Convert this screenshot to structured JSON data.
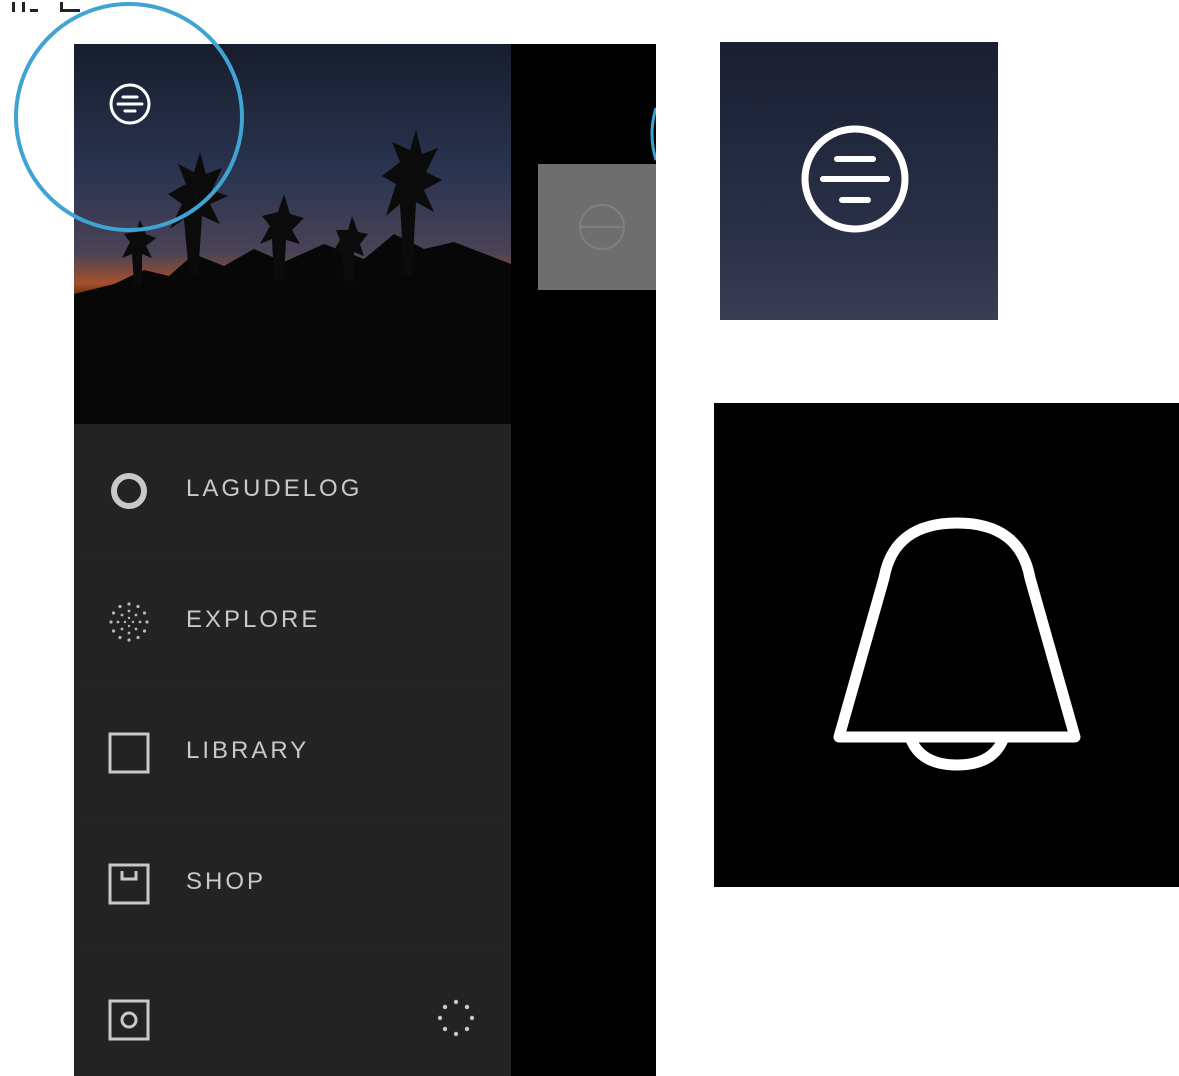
{
  "drawer": {
    "items": [
      {
        "label": "LAGUDELOG",
        "icon": "circle-ring-icon"
      },
      {
        "label": "EXPLORE",
        "icon": "dotted-circle-icon"
      },
      {
        "label": "LIBRARY",
        "icon": "square-outline-icon"
      },
      {
        "label": "SHOP",
        "icon": "shop-box-icon"
      }
    ],
    "bottom": {
      "left_icon": "camera-square-icon",
      "right_icon": "loading-dots-icon"
    }
  },
  "icons": {
    "menu_toggle": "menu-lines-circle-icon",
    "zoom_bell": "bell-icon"
  },
  "colors": {
    "drawer_bg": "#232323",
    "highlight_circle": "#3fa3d3",
    "label": "#c9c9c9",
    "background": "#000000"
  }
}
